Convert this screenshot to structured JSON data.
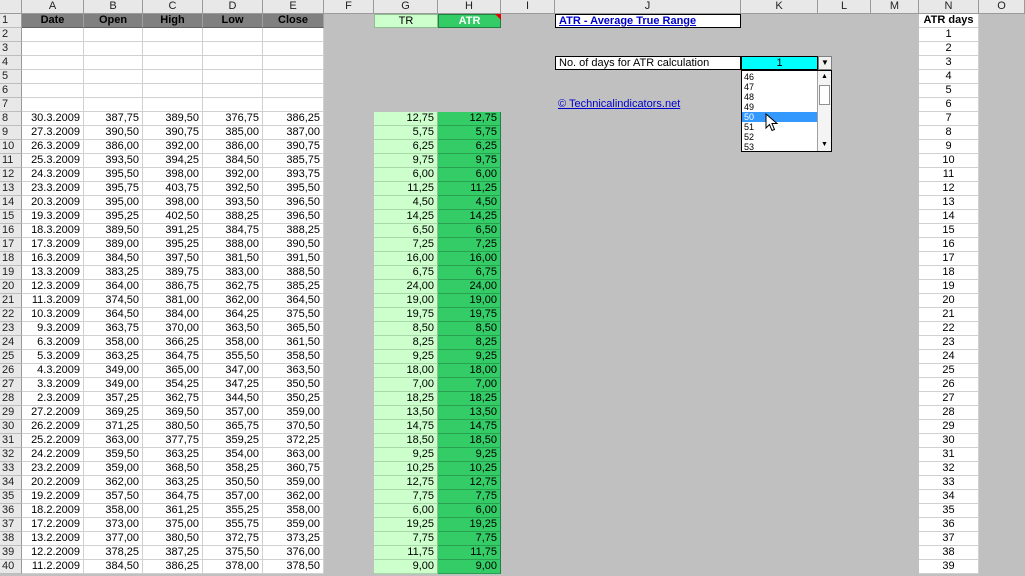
{
  "columns": [
    "A",
    "B",
    "C",
    "D",
    "E",
    "F",
    "G",
    "H",
    "I",
    "J",
    "K",
    "L",
    "M",
    "N",
    "O"
  ],
  "header_row": {
    "date": "Date",
    "open": "Open",
    "high": "High",
    "low": "Low",
    "close": "Close",
    "tr": "TR",
    "atr": "ATR",
    "atr_days": "ATR days"
  },
  "title": "ATR - Average True Range",
  "label_days": "No. of days for ATR calculation",
  "days_value": "1",
  "link_text": "© Technicalindicators.net",
  "dropdown_options": [
    "46",
    "47",
    "48",
    "49",
    "50",
    "51",
    "52",
    "53"
  ],
  "dropdown_selected": "50",
  "rows": [
    [
      "30.3.2009",
      "387,75",
      "389,50",
      "376,75",
      "386,25",
      "12,75",
      "12,75"
    ],
    [
      "27.3.2009",
      "390,50",
      "390,75",
      "385,00",
      "387,00",
      "5,75",
      "5,75"
    ],
    [
      "26.3.2009",
      "386,00",
      "392,00",
      "386,00",
      "390,75",
      "6,25",
      "6,25"
    ],
    [
      "25.3.2009",
      "393,50",
      "394,25",
      "384,50",
      "385,75",
      "9,75",
      "9,75"
    ],
    [
      "24.3.2009",
      "395,50",
      "398,00",
      "392,00",
      "393,75",
      "6,00",
      "6,00"
    ],
    [
      "23.3.2009",
      "395,75",
      "403,75",
      "392,50",
      "395,50",
      "11,25",
      "11,25"
    ],
    [
      "20.3.2009",
      "395,00",
      "398,00",
      "393,50",
      "396,50",
      "4,50",
      "4,50"
    ],
    [
      "19.3.2009",
      "395,25",
      "402,50",
      "388,25",
      "396,50",
      "14,25",
      "14,25"
    ],
    [
      "18.3.2009",
      "389,50",
      "391,25",
      "384,75",
      "388,25",
      "6,50",
      "6,50"
    ],
    [
      "17.3.2009",
      "389,00",
      "395,25",
      "388,00",
      "390,50",
      "7,25",
      "7,25"
    ],
    [
      "16.3.2009",
      "384,50",
      "397,50",
      "381,50",
      "391,50",
      "16,00",
      "16,00"
    ],
    [
      "13.3.2009",
      "383,25",
      "389,75",
      "383,00",
      "388,50",
      "6,75",
      "6,75"
    ],
    [
      "12.3.2009",
      "364,00",
      "386,75",
      "362,75",
      "385,25",
      "24,00",
      "24,00"
    ],
    [
      "11.3.2009",
      "374,50",
      "381,00",
      "362,00",
      "364,50",
      "19,00",
      "19,00"
    ],
    [
      "10.3.2009",
      "364,50",
      "384,00",
      "364,25",
      "375,50",
      "19,75",
      "19,75"
    ],
    [
      "9.3.2009",
      "363,75",
      "370,00",
      "363,50",
      "365,50",
      "8,50",
      "8,50"
    ],
    [
      "6.3.2009",
      "358,00",
      "366,25",
      "358,00",
      "361,50",
      "8,25",
      "8,25"
    ],
    [
      "5.3.2009",
      "363,25",
      "364,75",
      "355,50",
      "358,50",
      "9,25",
      "9,25"
    ],
    [
      "4.3.2009",
      "349,00",
      "365,00",
      "347,00",
      "363,50",
      "18,00",
      "18,00"
    ],
    [
      "3.3.2009",
      "349,00",
      "354,25",
      "347,25",
      "350,50",
      "7,00",
      "7,00"
    ],
    [
      "2.3.2009",
      "357,25",
      "362,75",
      "344,50",
      "350,25",
      "18,25",
      "18,25"
    ],
    [
      "27.2.2009",
      "369,25",
      "369,50",
      "357,00",
      "359,00",
      "13,50",
      "13,50"
    ],
    [
      "26.2.2009",
      "371,25",
      "380,50",
      "365,75",
      "370,50",
      "14,75",
      "14,75"
    ],
    [
      "25.2.2009",
      "363,00",
      "377,75",
      "359,25",
      "372,25",
      "18,50",
      "18,50"
    ],
    [
      "24.2.2009",
      "359,50",
      "363,25",
      "354,00",
      "363,00",
      "9,25",
      "9,25"
    ],
    [
      "23.2.2009",
      "359,00",
      "368,50",
      "358,25",
      "360,75",
      "10,25",
      "10,25"
    ],
    [
      "20.2.2009",
      "362,00",
      "363,25",
      "350,50",
      "359,00",
      "12,75",
      "12,75"
    ],
    [
      "19.2.2009",
      "357,50",
      "364,75",
      "357,00",
      "362,00",
      "7,75",
      "7,75"
    ],
    [
      "18.2.2009",
      "358,00",
      "361,25",
      "355,25",
      "358,00",
      "6,00",
      "6,00"
    ],
    [
      "17.2.2009",
      "373,00",
      "375,00",
      "355,75",
      "359,00",
      "19,25",
      "19,25"
    ],
    [
      "13.2.2009",
      "377,00",
      "380,50",
      "372,75",
      "373,25",
      "7,75",
      "7,75"
    ],
    [
      "12.2.2009",
      "378,25",
      "387,25",
      "375,50",
      "376,00",
      "11,75",
      "11,75"
    ],
    [
      "11.2.2009",
      "384,50",
      "386,25",
      "378,00",
      "378,50",
      "9,00",
      "9,00"
    ]
  ]
}
